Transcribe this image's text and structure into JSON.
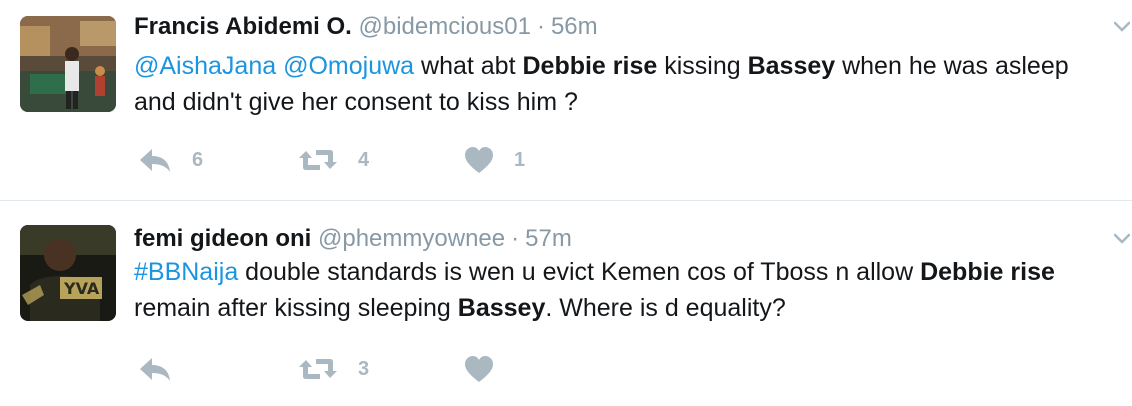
{
  "colors": {
    "link": "#1b95e0",
    "muted": "#8899a6",
    "action_icon": "#aab8c2",
    "divider": "#e1e8ed"
  },
  "tweets": [
    {
      "name": "Francis Abidemi O.",
      "handle": "@bidemcious01",
      "time": "56m",
      "text": {
        "mention1": "@AishaJana",
        "mention2": "@Omojuwa",
        "p1": " what abt ",
        "b1": "Debbie rise",
        "p2": " kissing ",
        "b2": "Bassey",
        "p3": " when he was asleep and didn't give her consent to kiss him ?"
      },
      "reply_count": "6",
      "retweet_count": "4",
      "like_count": "1",
      "icons": [
        "reply-icon",
        "retweet-icon",
        "heart-icon",
        "caret-down-icon"
      ]
    },
    {
      "name": "femi gideon oni",
      "handle": "@phemmyownee",
      "time": "57m",
      "text": {
        "hashtag": "#BBNaija",
        "p1": " double standards is wen u evict Kemen cos of Tboss n allow ",
        "b1": "Debbie rise",
        "p2": " remain after kissing sleeping ",
        "b2": "Bassey",
        "p3": ". Where is d equality?"
      },
      "reply_count": "",
      "retweet_count": "3",
      "like_count": "",
      "icons": [
        "reply-icon",
        "retweet-icon",
        "heart-icon",
        "caret-down-icon"
      ]
    }
  ]
}
